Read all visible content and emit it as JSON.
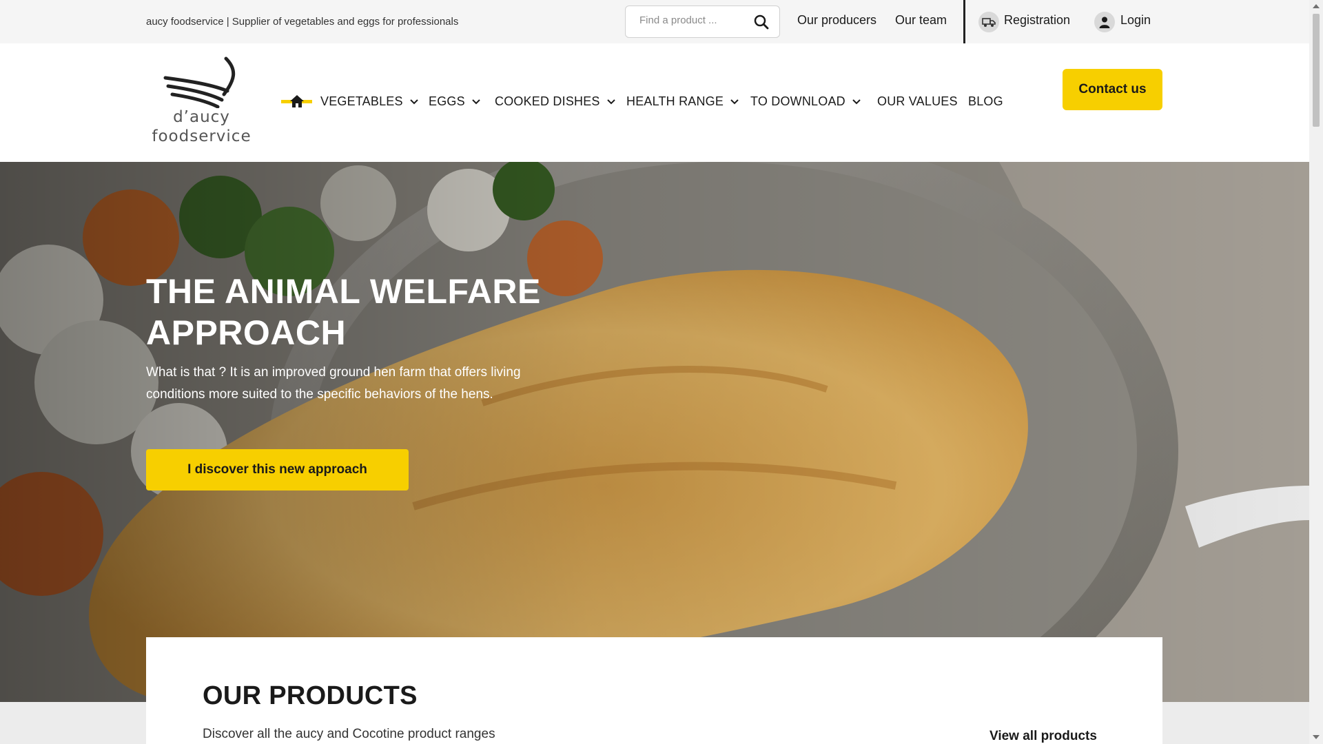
{
  "topbar": {
    "tagline": "aucy foodservice | Supplier of vegetables and eggs for professionals",
    "search_placeholder": "Find a product ...",
    "links": {
      "producers": "Our producers",
      "team": "Our team",
      "registration": "Registration",
      "login": "Login"
    },
    "icons": [
      "search-icon",
      "truck-icon",
      "user-icon"
    ]
  },
  "header": {
    "logo_line1": "d’aucy",
    "logo_line2": "foodservice",
    "nav": {
      "vegetables": "VEGETABLES",
      "eggs": "EGGS",
      "cooked": "COOKED DISHES",
      "health": "HEALTH RANGE",
      "download": "TO DOWNLOAD",
      "values": "OUR VALUES",
      "blog": "BLOG"
    },
    "contact": "Contact us"
  },
  "hero": {
    "title": "THE ANIMAL WELFARE APPROACH",
    "text": "What is that ? It is an improved ground hen farm that offers living conditions more suited to the specific behaviors of the hens.",
    "button": "I discover this new approach"
  },
  "products": {
    "title": "OUR PRODUCTS",
    "subtitle": "Discover all the aucy and Cocotine product ranges",
    "link": "View all products"
  },
  "colors": {
    "accent": "#f7cf00",
    "text": "#1a1a1a",
    "topbar_bg": "#f5f5f5"
  }
}
